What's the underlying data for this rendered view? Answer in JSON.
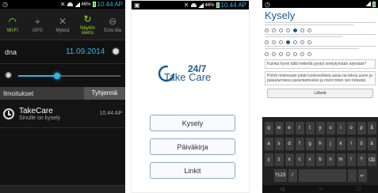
{
  "panel1": {
    "status": {
      "signal": "46%",
      "time": "10.44 AP"
    },
    "quick_settings": [
      {
        "label": "Wi-Fi",
        "icon": "wifi-icon",
        "on": true
      },
      {
        "label": "GPS",
        "icon": "gps-icon",
        "on": false
      },
      {
        "label": "Mykkä",
        "icon": "mute-icon",
        "on": false
      },
      {
        "label": "Näytön kierto",
        "icon": "rotate-icon",
        "on": true
      },
      {
        "label": "Esto-tila",
        "icon": "block-icon",
        "on": false
      }
    ],
    "carrier": "dna",
    "date": "11.09.2014",
    "brightness_level": 0.38,
    "notifications_label": "Ilmoitukset",
    "clear_label": "Tyhjennä",
    "notification": {
      "title": "TakeCare",
      "subtitle": "Sinulle on kysely",
      "time": "10.44 AP"
    }
  },
  "panel2": {
    "status": {
      "signal": "46%",
      "time": "10.44 AP"
    },
    "logo": {
      "top": "24/7",
      "bottom": "Take Care"
    },
    "buttons": [
      "Kysely",
      "Päiväkirja",
      "Linkit"
    ],
    "brand_color": "#1b5a8e"
  },
  "panel3": {
    "title": "Kysely",
    "field_1": "Kuinka hyvin tällä hetkellä pystyt selviytymään arjestasi?",
    "field_2": "Pohdi mielessäsi jotain konkreettista asiaa tai tekoa usein ja palautumisesi parantamiseksi ja mieti miten sen toteutat.",
    "submit_label": "Lähetä",
    "keyboard_rows": [
      [
        "q",
        "w",
        "e",
        "r",
        "t",
        "y",
        "u",
        "i",
        "o",
        "p",
        "å"
      ],
      [
        "a",
        "s",
        "d",
        "f",
        "g",
        "h",
        "j",
        "k",
        "l",
        "ö",
        "ä"
      ],
      [
        "⇧",
        "z",
        "x",
        "c",
        "v",
        "b",
        "n",
        "m",
        "!",
        "?",
        "⌫"
      ],
      [
        "?123",
        "/",
        " ",
        ".",
        "↵"
      ]
    ]
  }
}
